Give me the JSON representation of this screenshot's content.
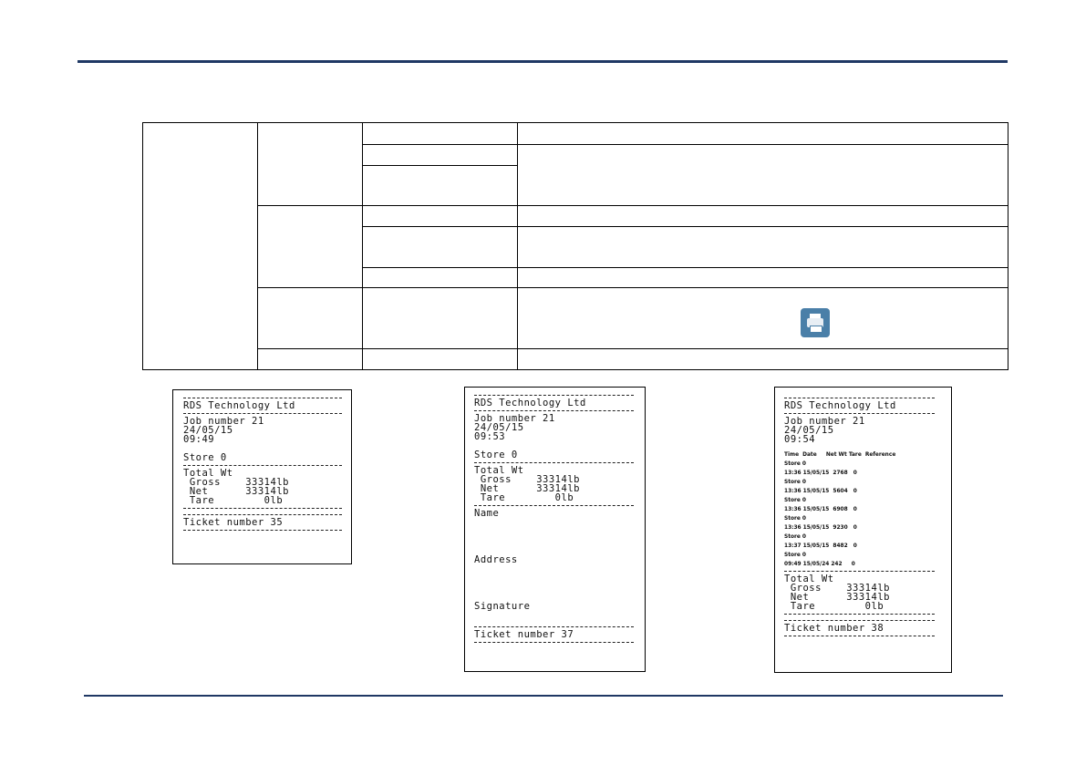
{
  "ticket1": {
    "company": "RDS Technology Ltd",
    "job": "Job number 21",
    "date": "24/05/15",
    "time": "09:49",
    "store": "Store 0",
    "total": "Total Wt",
    "gross": " Gross    33314lb",
    "net": " Net      33314lb",
    "tare": " Tare        0lb",
    "ticket": "Ticket number 35"
  },
  "ticket2": {
    "company": "RDS Technology Ltd",
    "job": "Job number 21",
    "date": "24/05/15",
    "time": "09:53",
    "store": "Store 0",
    "total": "Total Wt",
    "gross": " Gross    33314lb",
    "net": " Net      33314lb",
    "tare": " Tare        0lb",
    "name": "Name",
    "address": "Address",
    "signature": "Signature",
    "ticket": "Ticket number 37"
  },
  "ticket3": {
    "company": "RDS Technology Ltd",
    "job": "Job number 21",
    "date": "24/05/15",
    "time": "09:54",
    "header": "Time  Date     Net Wt Tare  Reference",
    "rows": [
      {
        "store": "Store 0",
        "line": "13:36 15/05/15  2768   0"
      },
      {
        "store": "Store 0",
        "line": "13:36 15/05/15  5604   0"
      },
      {
        "store": "Store 0",
        "line": "13:36 15/05/15  6908   0"
      },
      {
        "store": "Store 0",
        "line": "13:36 15/05/15  9230   0"
      },
      {
        "store": "Store 0",
        "line": "13:37 15/05/15  8482   0"
      },
      {
        "store": "Store 0",
        "line": "09:49 15/05/24 242     0"
      }
    ],
    "total": "Total Wt",
    "gross": " Gross    33314lb",
    "net": " Net      33314lb",
    "tare": " Tare        0lb",
    "ticket": "Ticket number 38"
  },
  "colors": {
    "rule": "#1f3864",
    "icon": "#4a7fa8"
  },
  "icons": {
    "print": "printer-icon"
  }
}
